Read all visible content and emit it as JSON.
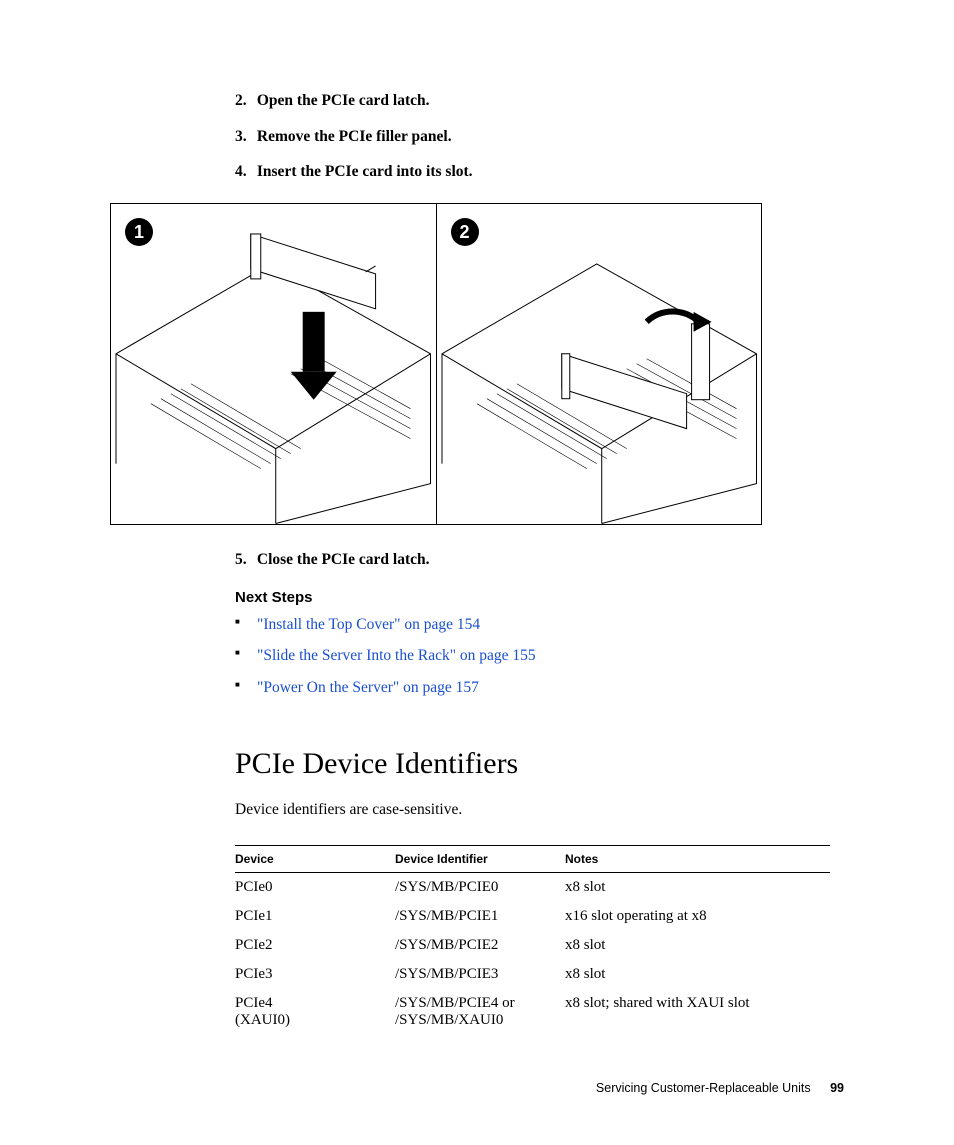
{
  "steps_top": [
    {
      "num": "2.",
      "text": "Open the PCIe card latch."
    },
    {
      "num": "3.",
      "text": "Remove the PCIe filler panel."
    },
    {
      "num": "4.",
      "text": "Insert the PCIe card into its slot."
    }
  ],
  "figure": {
    "callouts": [
      "1",
      "2"
    ]
  },
  "steps_after_figure": [
    {
      "num": "5.",
      "text": "Close the PCIe card latch."
    }
  ],
  "next_steps_heading": "Next Steps",
  "next_steps": [
    {
      "label": "\"Install the Top Cover\" on page 154"
    },
    {
      "label": "\"Slide the Server Into the Rack\" on page 155"
    },
    {
      "label": "\"Power On the Server\" on page 157"
    }
  ],
  "section": {
    "heading": "PCIe Device Identifiers",
    "intro": "Device identifiers are case-sensitive."
  },
  "table": {
    "headers": {
      "device": "Device",
      "identifier": "Device Identifier",
      "notes": "Notes"
    },
    "rows": [
      {
        "device": "PCIe0",
        "identifier": "/SYS/MB/PCIE0",
        "notes": "x8 slot"
      },
      {
        "device": "PCIe1",
        "identifier": "/SYS/MB/PCIE1",
        "notes": "x16 slot operating at x8"
      },
      {
        "device": "PCIe2",
        "identifier": "/SYS/MB/PCIE2",
        "notes": "x8 slot"
      },
      {
        "device": "PCIe3",
        "identifier": "/SYS/MB/PCIE3",
        "notes": "x8 slot"
      },
      {
        "device": "PCIe4\n(XAUI0)",
        "identifier": "/SYS/MB/PCIE4 or\n/SYS/MB/XAUI0",
        "notes": "x8 slot; shared with XAUI slot"
      }
    ]
  },
  "footer": {
    "chapter": "Servicing Customer-Replaceable Units",
    "page": "99"
  }
}
